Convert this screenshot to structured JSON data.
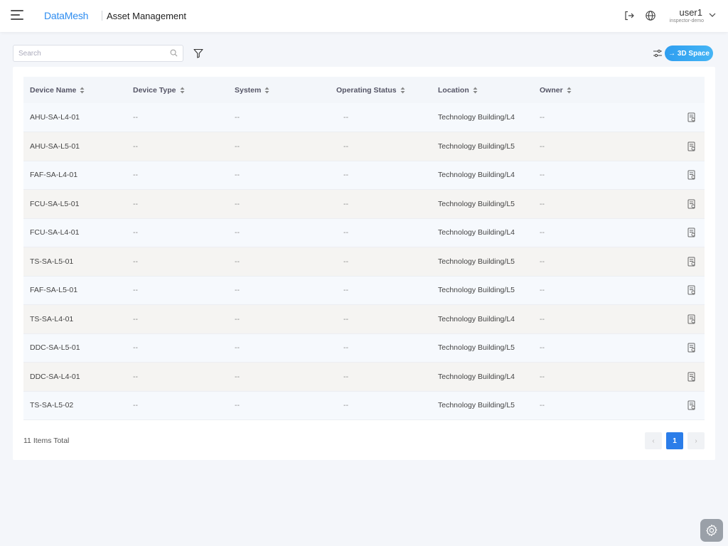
{
  "header": {
    "logo": "DataMesh",
    "title": "Asset Management",
    "user_name": "user1",
    "user_org": "inspector-demo"
  },
  "toolbar": {
    "search_placeholder": "Search",
    "space_button": "→ 3D Space"
  },
  "table": {
    "columns": [
      "Device Name",
      "Device Type",
      "System",
      "Operating Status",
      "Location",
      "Owner"
    ],
    "rows": [
      {
        "name": "AHU-SA-L4-01",
        "type": "--",
        "system": "--",
        "status": "--",
        "location": "Technology Building/L4",
        "owner": "--"
      },
      {
        "name": "AHU-SA-L5-01",
        "type": "--",
        "system": "--",
        "status": "--",
        "location": "Technology Building/L5",
        "owner": "--"
      },
      {
        "name": "FAF-SA-L4-01",
        "type": "--",
        "system": "--",
        "status": "--",
        "location": "Technology Building/L4",
        "owner": "--"
      },
      {
        "name": "FCU-SA-L5-01",
        "type": "--",
        "system": "--",
        "status": "--",
        "location": "Technology Building/L5",
        "owner": "--"
      },
      {
        "name": "FCU-SA-L4-01",
        "type": "--",
        "system": "--",
        "status": "--",
        "location": "Technology Building/L4",
        "owner": "--"
      },
      {
        "name": "TS-SA-L5-01",
        "type": "--",
        "system": "--",
        "status": "--",
        "location": "Technology Building/L5",
        "owner": "--"
      },
      {
        "name": "FAF-SA-L5-01",
        "type": "--",
        "system": "--",
        "status": "--",
        "location": "Technology Building/L5",
        "owner": "--"
      },
      {
        "name": "TS-SA-L4-01",
        "type": "--",
        "system": "--",
        "status": "--",
        "location": "Technology Building/L4",
        "owner": "--"
      },
      {
        "name": "DDC-SA-L5-01",
        "type": "--",
        "system": "--",
        "status": "--",
        "location": "Technology Building/L5",
        "owner": "--"
      },
      {
        "name": "DDC-SA-L4-01",
        "type": "--",
        "system": "--",
        "status": "--",
        "location": "Technology Building/L4",
        "owner": "--"
      },
      {
        "name": "TS-SA-L5-02",
        "type": "--",
        "system": "--",
        "status": "--",
        "location": "Technology Building/L5",
        "owner": "--"
      }
    ]
  },
  "pagination": {
    "total": "11 Items Total",
    "prev": "‹",
    "current": "1",
    "next": "›"
  },
  "colors": {
    "accent": "#2b7de9",
    "logo": "#2d8cf0",
    "space_button": "#35a6f2"
  },
  "icons": {
    "menu": "hamburger-menu-icon",
    "logout": "logout-icon",
    "language": "globe-icon",
    "dropdown": "chevron-down-icon",
    "search": "search-icon",
    "filter": "filter-funnel-icon",
    "settings": "sliders-icon",
    "row_action": "document-detail-icon",
    "fab": "gear-icon"
  }
}
